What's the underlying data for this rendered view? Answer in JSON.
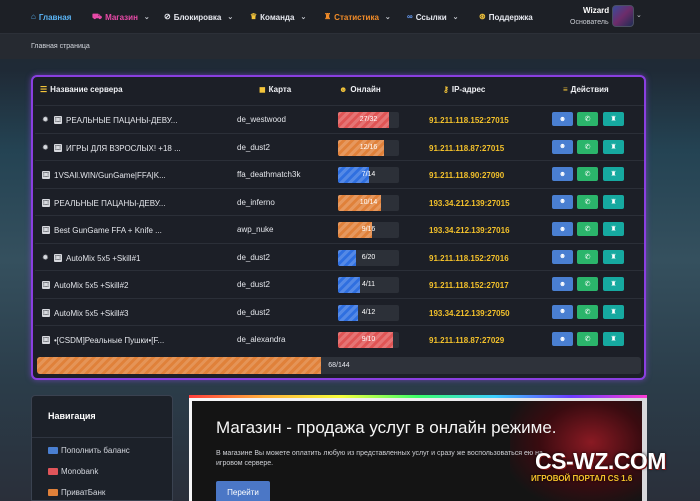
{
  "topnav": {
    "items": [
      {
        "label": "Главная",
        "icon": "home-icon",
        "color": "#5ab4f5",
        "dropdown": false
      },
      {
        "label": "Магазин",
        "icon": "cart-icon",
        "color": "#e94aa8",
        "dropdown": true
      },
      {
        "label": "Блокировка",
        "icon": "ban-icon",
        "color": "#ffffff",
        "dropdown": true
      },
      {
        "label": "Команда",
        "icon": "crown-icon",
        "color": "#f3c43a",
        "dropdown": true
      },
      {
        "label": "Статистика",
        "icon": "trophy-icon",
        "color": "#f28c28",
        "dropdown": true
      },
      {
        "label": "Ссылки",
        "icon": "link-icon",
        "color": "#6aa2ff",
        "dropdown": true
      },
      {
        "label": "Поддержка",
        "icon": "support-icon",
        "color": "#ffffff",
        "dropdown": false
      }
    ],
    "user": {
      "name": "Wizard",
      "role": "Основатель"
    }
  },
  "breadcrumb": "Главная страница",
  "servers": {
    "columns": {
      "name": "Название сервера",
      "map": "Карта",
      "online": "Онлайн",
      "ip": "IP-адрес",
      "actions": "Действия"
    },
    "rows": [
      {
        "gear": true,
        "name": "РЕАЛЬНЫЕ ПАЦАНЫ-ДЕВУ...",
        "map": "de_westwood",
        "online": "27/32",
        "fill": 0.84,
        "color": "#e05555",
        "ip": "91.211.118.152:27015"
      },
      {
        "gear": true,
        "name": "ИГРЫ ДЛЯ ВЗРОСЛЫХ! +18 ...",
        "map": "de_dust2",
        "online": "12/16",
        "fill": 0.75,
        "color": "#e0813a",
        "ip": "91.211.118.87:27015"
      },
      {
        "gear": false,
        "name": "1VSAll.WIN/GunGame|FFA|K...",
        "map": "ffa_deathmatch3k",
        "online": "7/14",
        "fill": 0.5,
        "color": "#2f6fe0",
        "ip": "91.211.118.90:27090"
      },
      {
        "gear": false,
        "name": "РЕАЛЬНЫЕ ПАЦАНЫ-ДЕВУ...",
        "map": "de_inferno",
        "online": "10/14",
        "fill": 0.71,
        "color": "#e0813a",
        "ip": "193.34.212.139:27015"
      },
      {
        "gear": false,
        "name": "Best GunGame FFA + Knife ...",
        "map": "awp_nuke",
        "online": "9/16",
        "fill": 0.56,
        "color": "#e0813a",
        "ip": "193.34.212.139:27016"
      },
      {
        "gear": true,
        "name": "AutoMix 5x5 +Skill#1",
        "map": "de_dust2",
        "online": "6/20",
        "fill": 0.3,
        "color": "#2f6fe0",
        "ip": "91.211.118.152:27016"
      },
      {
        "gear": false,
        "name": "AutoMix 5x5 +Skill#2",
        "map": "de_dust2",
        "online": "4/11",
        "fill": 0.36,
        "color": "#2f6fe0",
        "ip": "91.211.118.152:27017"
      },
      {
        "gear": false,
        "name": "AutoMix 5x5 +Skill#3",
        "map": "de_dust2",
        "online": "4/12",
        "fill": 0.33,
        "color": "#2f6fe0",
        "ip": "193.34.212.139:27050"
      },
      {
        "gear": false,
        "name": "•[CSDM]Реальные Пушки•[F...",
        "map": "de_alexandra",
        "online": "9/10",
        "fill": 0.9,
        "color": "#e05555",
        "ip": "91.211.118.87:27029"
      }
    ],
    "total": {
      "label": "68/144",
      "fill": 0.47
    }
  },
  "sidebar": {
    "title": "Навигация",
    "links": [
      {
        "label": "Пополнить баланс",
        "color": "#4a7fd1"
      },
      {
        "label": "Monobank",
        "color": "#e0555a"
      },
      {
        "label": "ПриватБанк",
        "color": "#e0813a"
      }
    ]
  },
  "banner": {
    "title": "Магазин - продажа услуг в онлайн режиме.",
    "desc": "В магазине Вы можете оплатить любую из представленных услуг и сразу же воспользоваться ею на игровом сервере.",
    "button": "Перейти",
    "brand": "CS-WZ.COM",
    "brand_sub": "ИГРОВОЙ ПОРТАЛ CS 1.6"
  }
}
